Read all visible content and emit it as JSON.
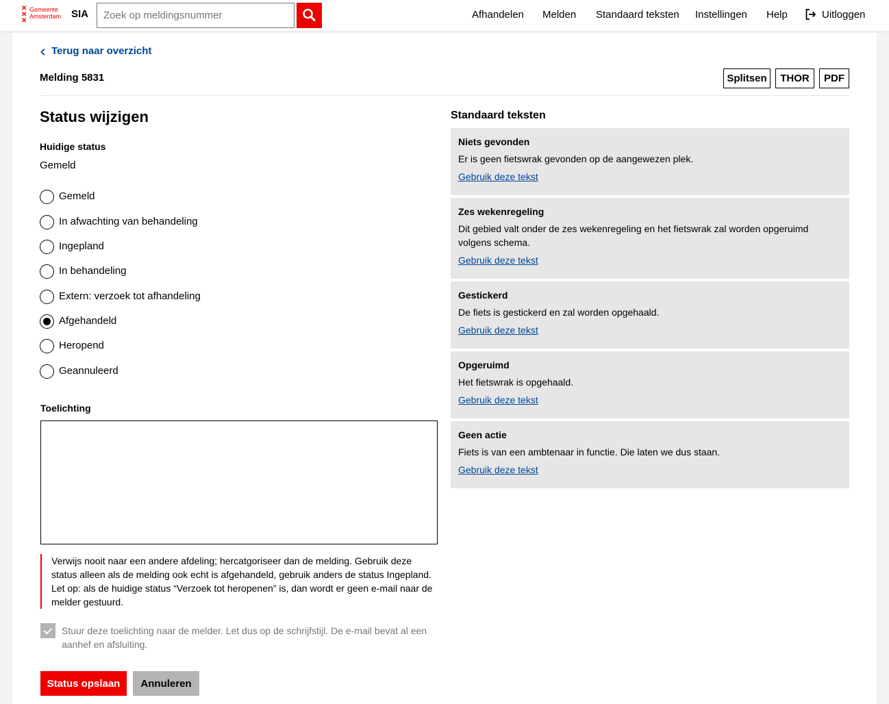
{
  "header": {
    "logo_line1": "Gemeente",
    "logo_line2": "Amsterdam",
    "app_name": "SIA",
    "search_placeholder": "Zoek op meldingsnummer",
    "nav": [
      "Afhandelen",
      "Melden",
      "Standaard teksten",
      "Instellingen",
      "Help"
    ],
    "logout_label": "Uitloggen",
    "icons": {
      "search": "search-icon",
      "logout": "logout-icon",
      "logo": "amsterdam-crosses-logo"
    },
    "accent_color": "#ec0000"
  },
  "breadcrumb": {
    "back_label": "Terug naar overzicht"
  },
  "incident": {
    "title": "Melding 5831",
    "actions": [
      "Splitsen",
      "THOR",
      "PDF"
    ]
  },
  "status_form": {
    "heading": "Status wijzigen",
    "current_label": "Huidige status",
    "current_value": "Gemeld",
    "options": [
      {
        "label": "Gemeld",
        "selected": false
      },
      {
        "label": "In afwachting van behandeling",
        "selected": false
      },
      {
        "label": "Ingepland",
        "selected": false
      },
      {
        "label": "In behandeling",
        "selected": false
      },
      {
        "label": "Extern: verzoek tot afhandeling",
        "selected": false
      },
      {
        "label": "Afgehandeld",
        "selected": true
      },
      {
        "label": "Heropend",
        "selected": false
      },
      {
        "label": "Geannuleerd",
        "selected": false
      }
    ],
    "toelichting_label": "Toelichting",
    "toelichting_value": "",
    "notice": "Verwijs nooit naar een andere afdeling; hercatgoriseer dan de melding. Gebruik deze status alleen als de melding ook echt is afgehandeld, gebruik anders de status Ingepland. Let op: als de huidige status “Verzoek tot heropenen” is, dan wordt er geen e-mail naar de melder gestuurd.",
    "send_checkbox_checked": true,
    "send_checkbox_label": "Stuur deze toelichting naar de melder. Let dus op de schrijfstijl. De e-mail bevat al een aanhef en afsluiting.",
    "save_label": "Status opslaan",
    "cancel_label": "Annuleren"
  },
  "standard_texts": {
    "heading": "Standaard teksten",
    "link_label": "Gebruik deze tekst",
    "items": [
      {
        "title": "Niets gevonden",
        "text": "Er is geen fietswrak gevonden op de aangewezen plek."
      },
      {
        "title": "Zes wekenregeling",
        "text": "Dit gebied valt onder de zes wekenregeling en het fietswrak zal worden opgeruimd volgens schema."
      },
      {
        "title": "Gestickerd",
        "text": "De fiets is gestickerd en zal worden opgehaald."
      },
      {
        "title": "Opgeruimd",
        "text": "Het fietswrak is opgehaald."
      },
      {
        "title": "Geen actie",
        "text": "Fiets is van een ambtenaar in functie. Die laten we dus staan."
      }
    ]
  }
}
